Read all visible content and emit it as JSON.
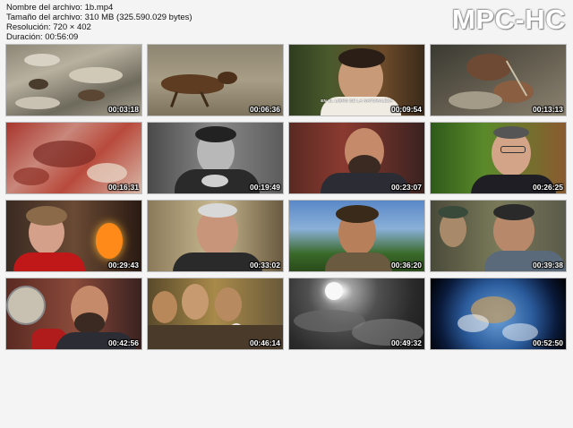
{
  "header": {
    "file_name": "Nombre del archivo: 1b.mp4",
    "file_size": "Tamaño del archivo: 310 MB (325.590.029 bytes)",
    "resolution": "Resolución: 720 × 402",
    "duration": "Duración: 00:56:09"
  },
  "logo": "MPC-HC",
  "thumbnails": [
    {
      "time": "00:03:18",
      "scene": "animals-on-rocks"
    },
    {
      "time": "00:06:36",
      "scene": "wolf-running"
    },
    {
      "time": "00:09:54",
      "scene": "presenter-with-caption",
      "caption": "EN EL LIBRO DE LA NATURALEZA"
    },
    {
      "time": "00:13:13",
      "scene": "hands-with-tools"
    },
    {
      "time": "00:16:31",
      "scene": "cave-painting"
    },
    {
      "time": "00:19:49",
      "scene": "man-in-black-and-white"
    },
    {
      "time": "00:23:07",
      "scene": "bearded-man"
    },
    {
      "time": "00:26:25",
      "scene": "man-with-glasses"
    },
    {
      "time": "00:29:43",
      "scene": "woman-by-fireplace"
    },
    {
      "time": "00:33:02",
      "scene": "grey-haired-man"
    },
    {
      "time": "00:36:20",
      "scene": "man-outdoors"
    },
    {
      "time": "00:39:38",
      "scene": "men-in-field"
    },
    {
      "time": "00:42:56",
      "scene": "bearded-man-red-chair"
    },
    {
      "time": "00:46:14",
      "scene": "group-of-men-with-bird"
    },
    {
      "time": "00:49:32",
      "scene": "moon-and-clouds"
    },
    {
      "time": "00:52:50",
      "scene": "earth-from-space"
    }
  ]
}
